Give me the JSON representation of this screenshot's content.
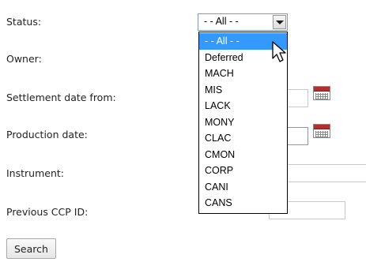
{
  "form": {
    "status_label": "Status:",
    "owner_label": "Owner:",
    "settlement_label": "Settlement date from:",
    "production_label": "Production date:",
    "instrument_label": "Instrument:",
    "ccp_label": "Previous CCP ID:",
    "settlement_value": "",
    "production_value": "",
    "instrument_value": "",
    "ccp_value": ""
  },
  "status_select": {
    "selected": "- - All - -",
    "options": [
      "- - All - -",
      "Deferred",
      "MACH",
      "MIS",
      "LACK",
      "MONY",
      "CLAC",
      "CMON",
      "CORP",
      "CANI",
      "CANS"
    ],
    "highlighted_option": "- - All - -"
  },
  "search_button": {
    "label": "Search"
  },
  "icons": {
    "calendar": "calendar-icon",
    "dropdown_arrow": "chevron-down-icon",
    "cursor": "mouse-pointer-icon"
  },
  "colors": {
    "highlight": "#3399ff",
    "highlight_text": "#ffffff",
    "calendar_header": "#b52e2e",
    "focused_border": "#6e9fd0"
  }
}
